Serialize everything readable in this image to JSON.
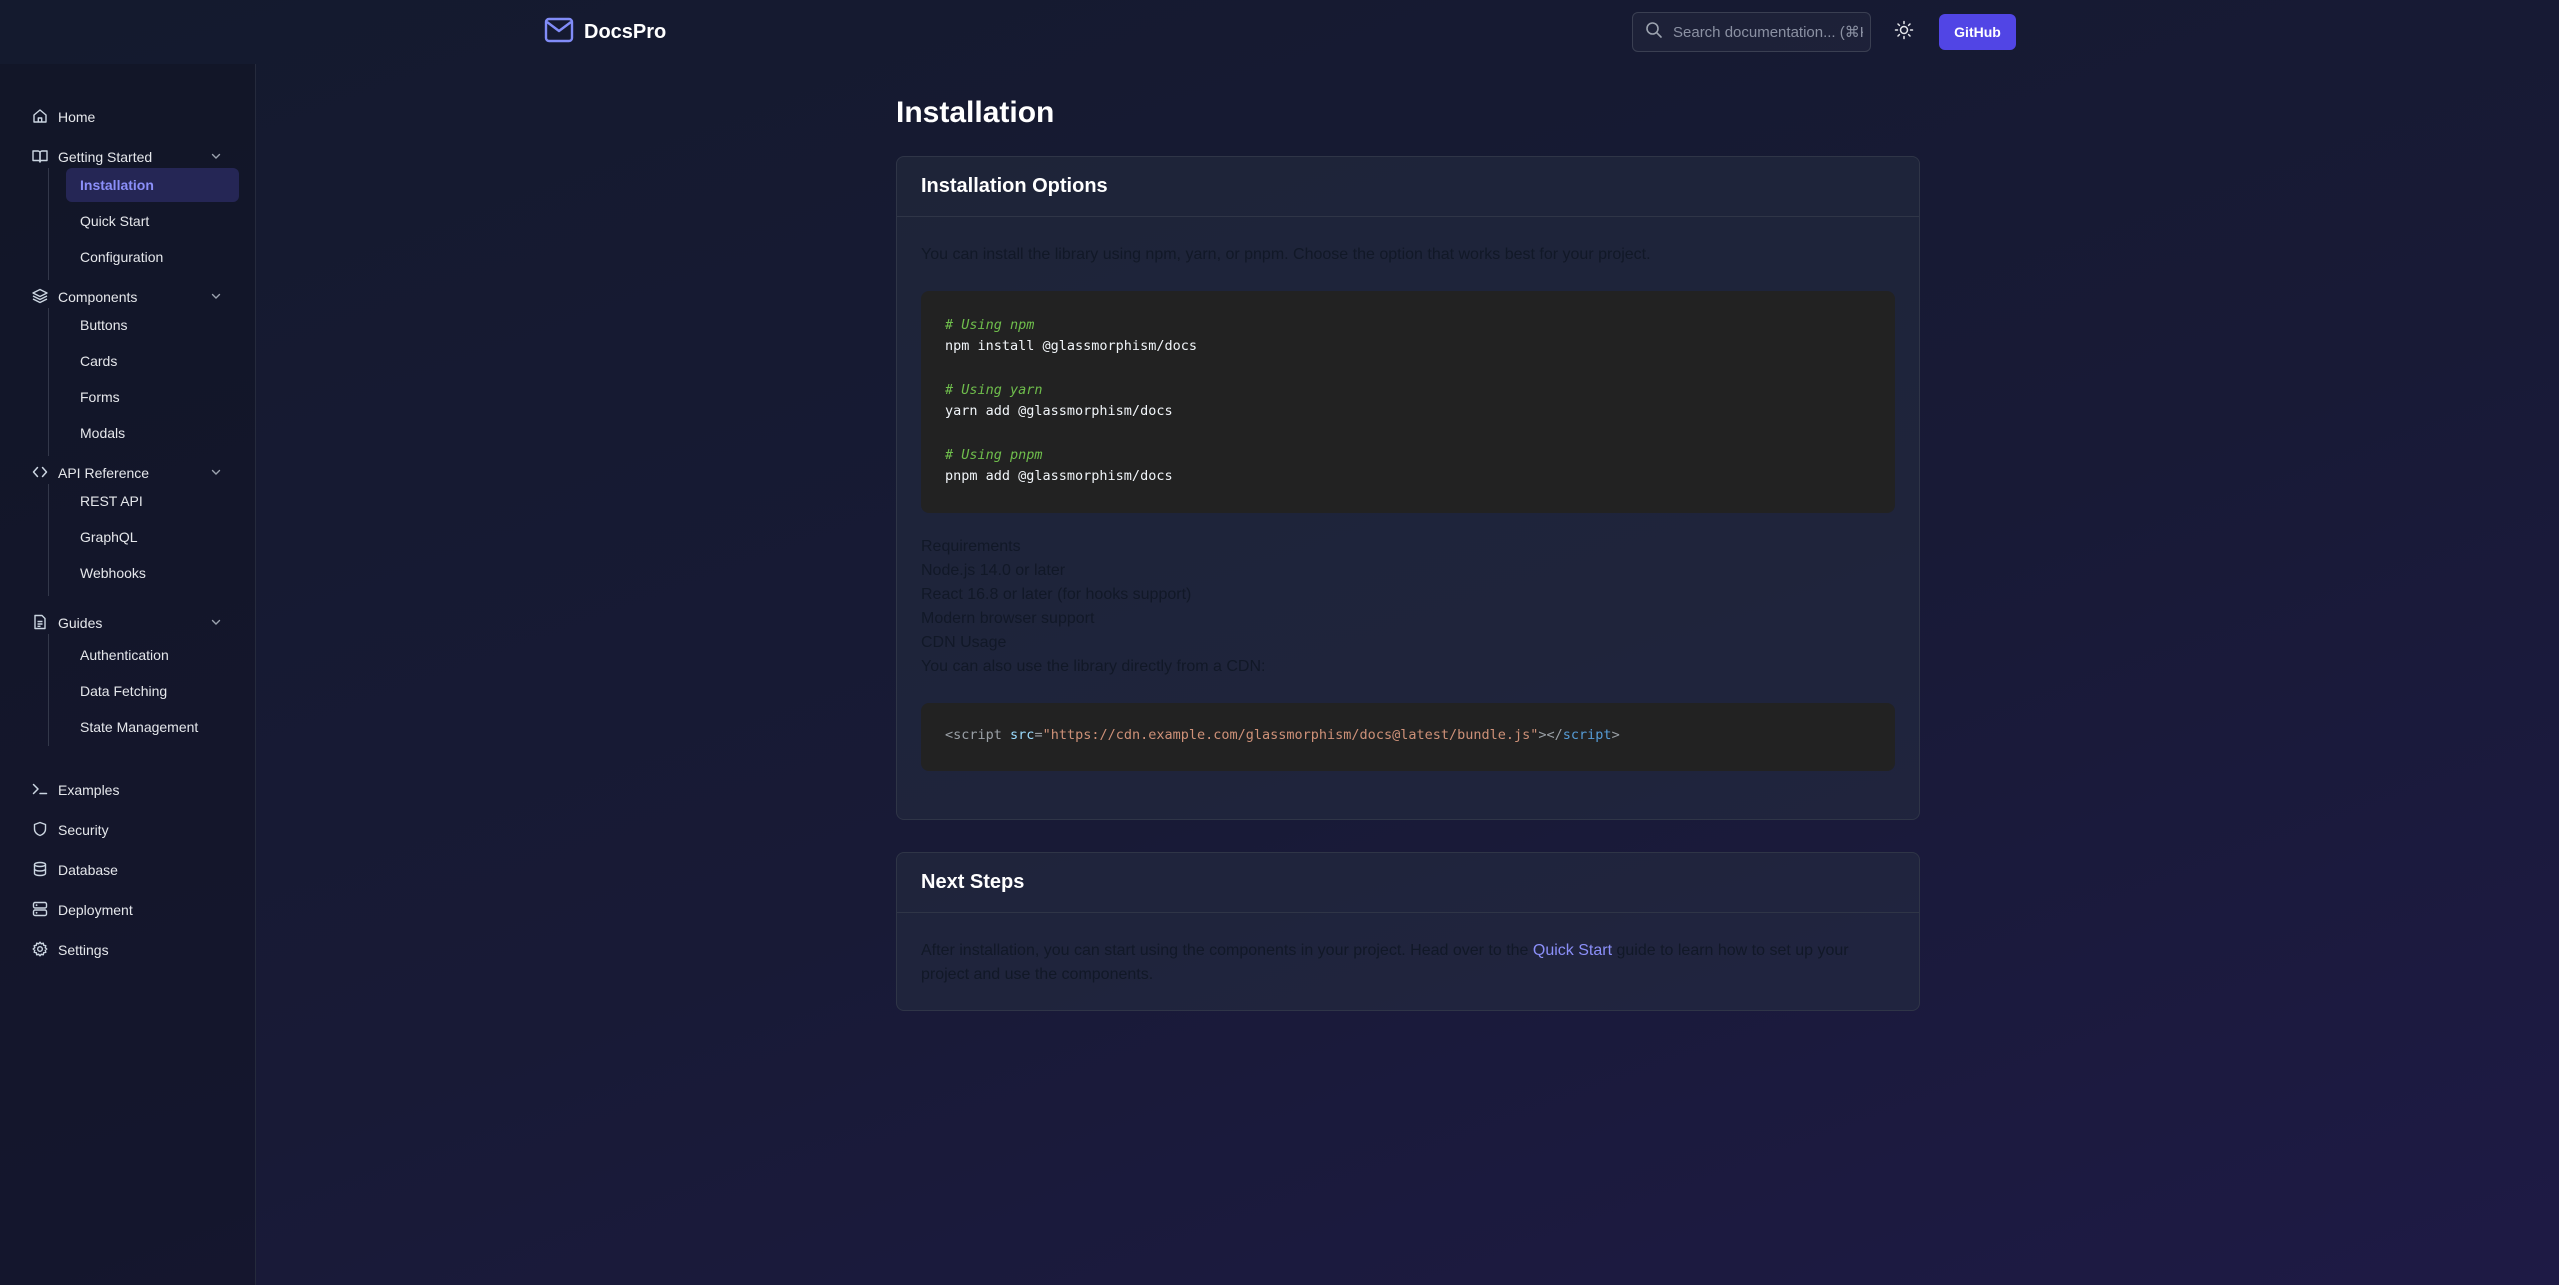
{
  "brand": {
    "name": "DocsPro",
    "accent": "#818cf8"
  },
  "header": {
    "search_placeholder": "Search documentation... (⌘K)",
    "github_label": "GitHub",
    "github_color": "#5145e5"
  },
  "sidebar": {
    "home": "Home",
    "getting_started": {
      "label": "Getting Started",
      "items": [
        "Installation",
        "Quick Start",
        "Configuration"
      ]
    },
    "components": {
      "label": "Components",
      "items": [
        "Buttons",
        "Cards",
        "Forms",
        "Modals"
      ]
    },
    "api_reference": {
      "label": "API Reference",
      "items": [
        "REST API",
        "GraphQL",
        "Webhooks"
      ]
    },
    "guides": {
      "label": "Guides",
      "items": [
        "Authentication",
        "Data Fetching",
        "State Management"
      ]
    },
    "examples": "Examples",
    "security": "Security",
    "database": "Database",
    "deployment": "Deployment",
    "settings": "Settings",
    "active_item": "Installation"
  },
  "main": {
    "title": "Installation",
    "options_card": {
      "title": "Installation Options",
      "intro": "You can install the library using npm, yarn, or pnpm. Choose the option that works best for your project.",
      "code": {
        "npm_comment": "# Using npm",
        "npm_cmd": "npm install @glassmorphism/docs",
        "yarn_comment": "# Using yarn",
        "yarn_cmd": "yarn add @glassmorphism/docs",
        "pnpm_comment": "# Using pnpm",
        "pnpm_cmd": "pnpm add @glassmorphism/docs"
      },
      "requirements": [
        "Requirements",
        "Node.js 14.0 or later",
        "React 16.8 or later (for hooks support)",
        "Modern browser support",
        "CDN Usage",
        "You can also use the library directly from a CDN:"
      ],
      "cdn_code": {
        "open_tag": "<script",
        "attr": "src",
        "eq": "=",
        "url": "\"https://cdn.example.com/glassmorphism/docs@latest/bundle.js\"",
        "gt": ">",
        "close_open": "</",
        "close_tag": "script",
        "close_gt": ">"
      }
    },
    "next_card": {
      "title": "Next Steps",
      "text_before": "After installation, you can start using the components in your project. Head over to the ",
      "link": "Quick Start",
      "text_after": " guide to learn how to set up your",
      "text_line2": "project and use the components."
    }
  }
}
